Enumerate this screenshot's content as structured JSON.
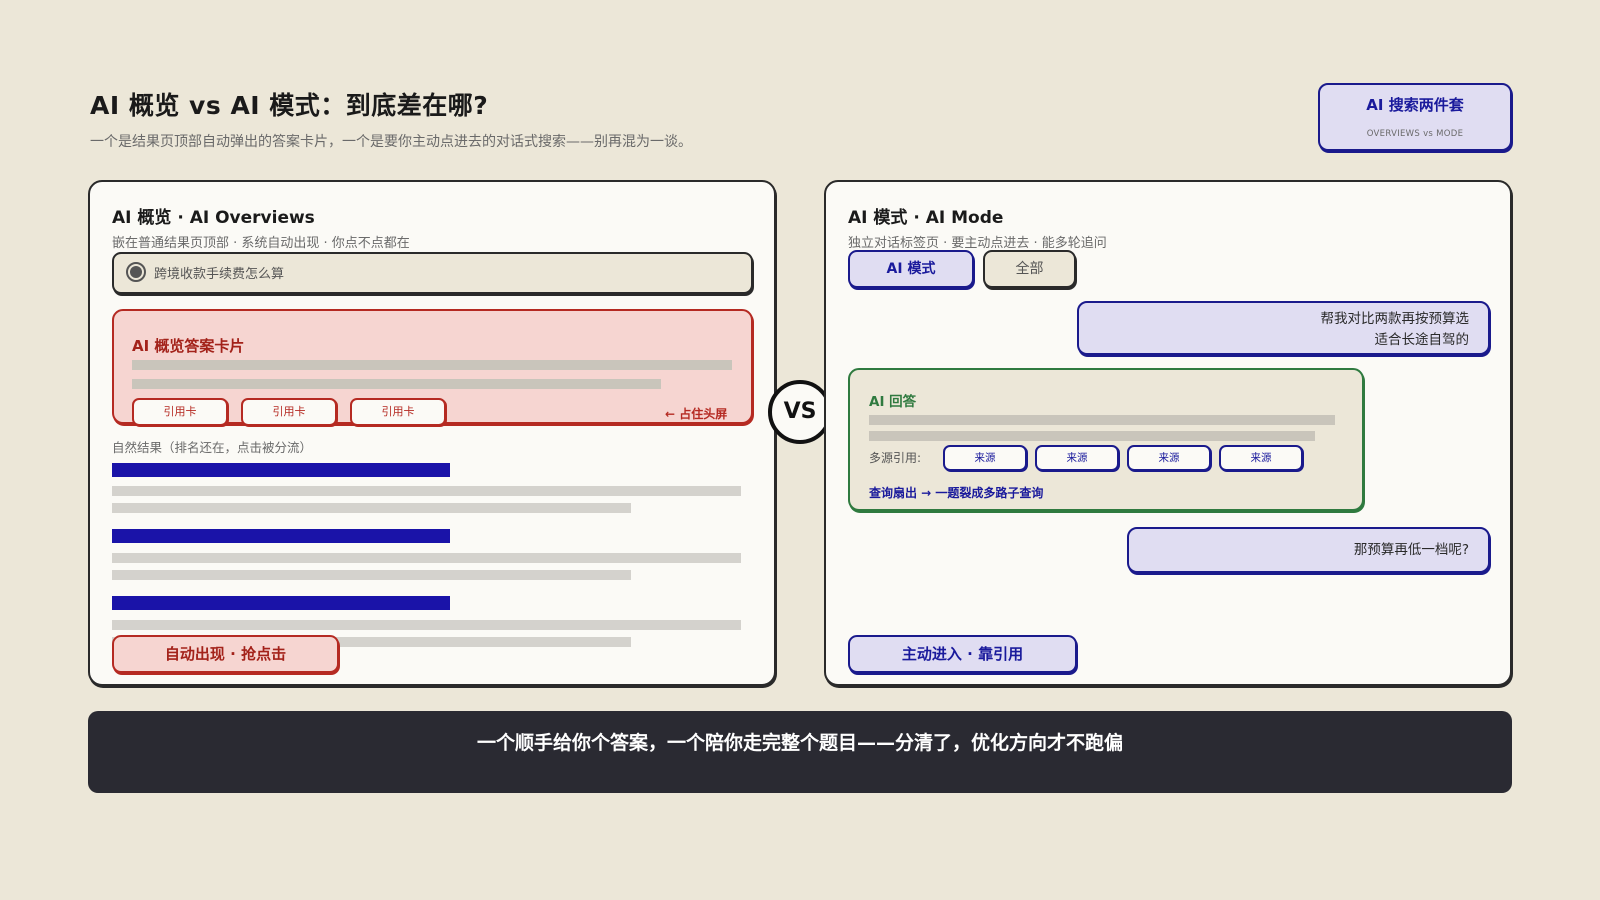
{
  "header": {
    "title": "AI 概览 vs AI 模式：到底差在哪?",
    "subtitle": "一个是结果页顶部自动弹出的答案卡片，一个是要你主动点进去的对话式搜索——别再混为一谈。"
  },
  "badge": {
    "title": "AI 搜索两件套",
    "subtitle": "OVERVIEWS vs MODE"
  },
  "left_panel": {
    "title": "AI 概览 · AI Overviews",
    "subtitle": "嵌在普通结果页顶部 · 系统自动出现 · 你点不点都在",
    "search_query": "跨境收款手续费怎么算",
    "card_title": "AI 概览答案卡片",
    "citations": [
      "引用卡",
      "引用卡",
      "引用卡"
    ],
    "card_note": "← 占住头屏",
    "organic_label": "自然结果（排名还在，点击被分流）",
    "tag": "自动出现 · 抢点击"
  },
  "vs_label": "VS",
  "right_panel": {
    "title": "AI 模式 · AI Mode",
    "subtitle": "独立对话标签页 · 要主动点进去 · 能多轮追问",
    "tabs": [
      "AI 模式",
      "全部"
    ],
    "user_message_1_line1": "帮我对比两款再按预算选",
    "user_message_1_line2": "适合长途自驾的",
    "answer_title": "AI 回答",
    "sources_label": "多源引用:",
    "sources": [
      "来源",
      "来源",
      "来源",
      "来源"
    ],
    "fanout_note": "查询扇出 → 一题裂成多路子查询",
    "user_message_2": "那预算再低一档呢?",
    "tag": "主动进入 · 靠引用"
  },
  "footer": {
    "text": "一个顺手给你个答案，一个陪你走完整个题目——分清了，优化方向才不跑偏"
  },
  "colors": {
    "background": "#ece7d8",
    "red_accent": "#b52a22",
    "blue_accent": "#1a1a8c",
    "green_accent": "#2f7a3f",
    "link_blue": "#1a13a8",
    "footer_bg": "#2a2a32"
  }
}
